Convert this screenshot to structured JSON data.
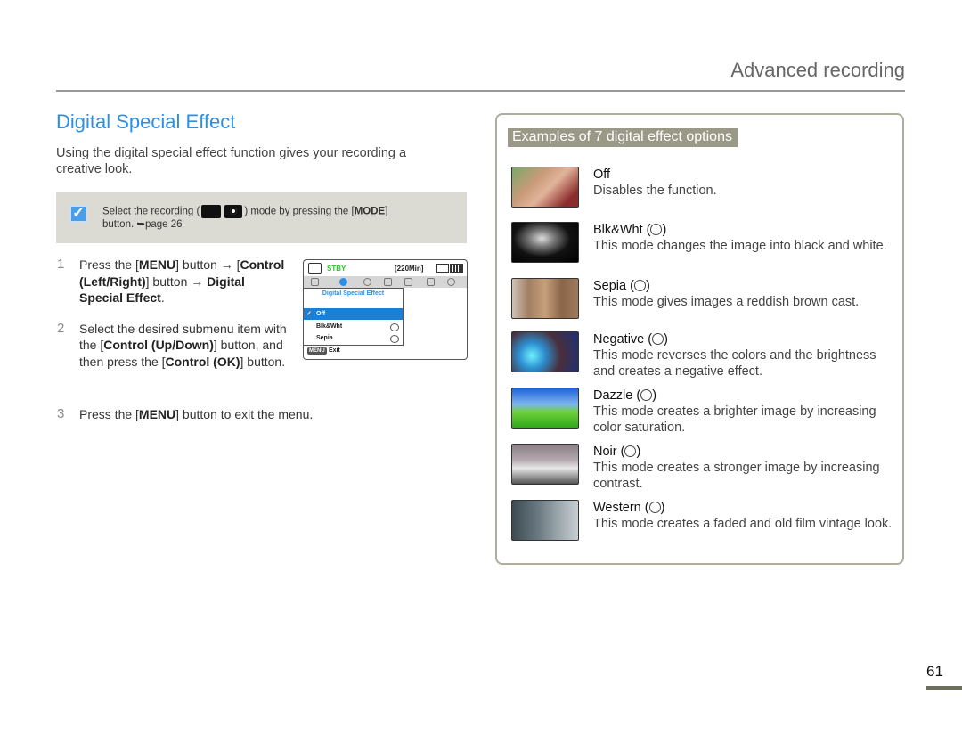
{
  "header": {
    "section_title": "Advanced recording"
  },
  "page": {
    "heading": "Digital Special Effect",
    "intro": "Using the digital special effect function gives your recording a creative look.",
    "page_number": "61"
  },
  "note": {
    "icon": "checkmark-icon",
    "text_before": "Select the recording (",
    "mode_icons": [
      "video-camera-icon",
      "photo-camera-icon"
    ],
    "text_after": ") mode by pressing the [",
    "button": "MODE",
    "text_end": "]",
    "line2": "button. ➥page 26"
  },
  "steps": [
    {
      "number": "1",
      "parts": [
        {
          "t": "Press the [",
          "b": false
        },
        {
          "t": "MENU",
          "b": true
        },
        {
          "t": "] button → [",
          "b": false
        },
        {
          "t": "Control (Left/Right)",
          "b": true
        },
        {
          "t": "] button → ",
          "b": false
        },
        {
          "t": "Digital Special Effect",
          "b": true
        },
        {
          "t": ".",
          "b": false
        }
      ]
    },
    {
      "number": "2",
      "parts": [
        {
          "t": "Select the desired submenu item with the [",
          "b": false
        },
        {
          "t": "Control (Up/Down)",
          "b": true
        },
        {
          "t": "] button, and then press the [",
          "b": false
        },
        {
          "t": "Control (OK)",
          "b": true
        },
        {
          "t": "] button.",
          "b": false
        }
      ]
    },
    {
      "number": "3",
      "parts": [
        {
          "t": "Press the [",
          "b": false
        },
        {
          "t": "MENU",
          "b": true
        },
        {
          "t": "] button to exit the menu.",
          "b": false
        }
      ]
    }
  ],
  "lcd": {
    "status": "STBY",
    "remaining": "[220Min]",
    "menu_title": "Digital Special Effect",
    "items": [
      {
        "label": "Off",
        "selected": true,
        "check": "✓"
      },
      {
        "label": "Blk&Wht",
        "selected": false
      },
      {
        "label": "Sepia",
        "selected": false
      }
    ],
    "menu_button": "MENU",
    "exit_label": "Exit",
    "status_color": "#2bc42b",
    "highlight_color": "#1b7fd6"
  },
  "examples": {
    "title": "Examples of 7 digital effect options",
    "items": [
      {
        "name": "Off",
        "has_icon": false,
        "desc": "Disables the function.",
        "thumb": "children-photo"
      },
      {
        "name": "Blk&Wht",
        "has_icon": true,
        "desc": "This mode changes the image into black and white.",
        "thumb": "bw-woman-photo"
      },
      {
        "name": "Sepia",
        "has_icon": true,
        "desc": "This mode gives images a reddish brown cast.",
        "thumb": "sepia-building-photo"
      },
      {
        "name": "Negative",
        "has_icon": true,
        "desc": "This mode reverses the colors and the brightness and creates a negative effect.",
        "thumb": "negative-flowers-photo"
      },
      {
        "name": "Dazzle",
        "has_icon": true,
        "desc": "This mode creates a brighter image by increasing color saturation.",
        "thumb": "dazzle-sky-photo"
      },
      {
        "name": "Noir",
        "has_icon": true,
        "desc": "This mode creates a stronger image by increasing contrast.",
        "thumb": "noir-car-photo"
      },
      {
        "name": "Western",
        "has_icon": true,
        "desc": "This mode creates a faded and old film vintage look.",
        "thumb": "western-street-photo"
      }
    ]
  },
  "colors": {
    "heading_blue": "#2b8fe4",
    "note_bg": "#dcdbd3",
    "panel_title_bg": "#9a9886",
    "panel_border": "#b0ad9c"
  }
}
